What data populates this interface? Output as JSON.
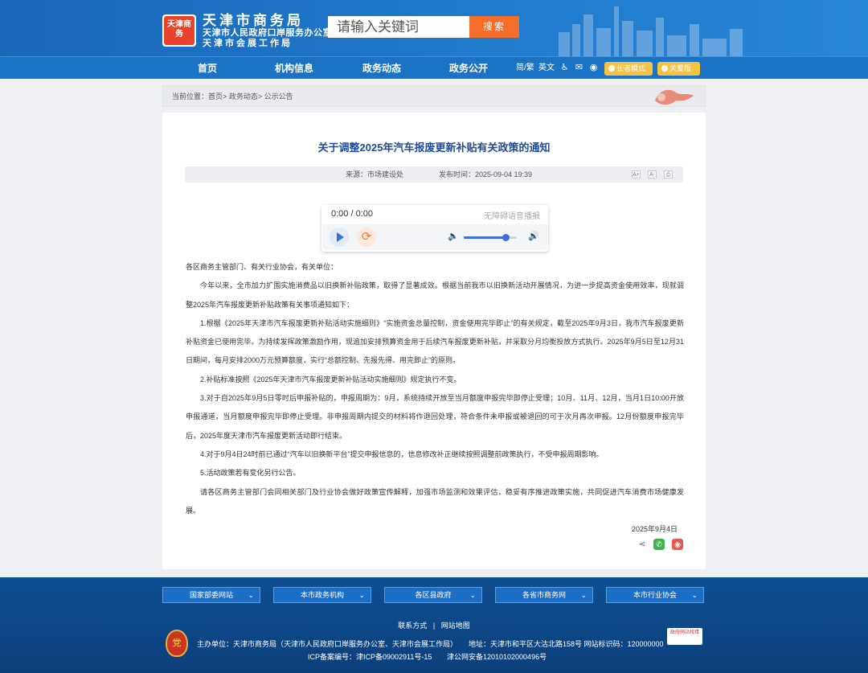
{
  "header": {
    "logo_text": "天津商务",
    "org_line1": "天津市商务局",
    "org_line2": "天津市人民政府口岸服务办公室",
    "org_line3": "天津市会展工作局",
    "search_placeholder": "请输入关键词",
    "search_button": "搜索"
  },
  "nav": {
    "items": [
      "首页",
      "机构信息",
      "政务动态",
      "政务公开"
    ],
    "lang_simple": "简/繁",
    "lang_english": "英文",
    "elder_mode": "长者模式",
    "care_version": "关爱版"
  },
  "breadcrumb": {
    "prefix": "当前位置：",
    "home": "首页",
    "level1": "政务动态",
    "level2": "公示公告",
    "sep": ">"
  },
  "article": {
    "title": "关于调整2025年汽车报废更新补贴有关政策的通知",
    "source": "来源：市场建设处",
    "publish_time": "发布时间：2025-09-04 19:39",
    "font_larger": "A+",
    "font_smaller": "A-",
    "paragraphs": [
      "各区商务主管部门、有关行业协会，有关单位：",
      "今年以来，全市加力扩围实施消费品以旧换新补贴政策，取得了显著成效。根据当前我市以旧换新活动开展情况，为进一步提高资金使用效率，现就调整2025年汽车报废更新补贴政策有关事项通知如下：",
      "1.根据《2025年天津市汽车报废更新补贴活动实施细则》“实施资金总量控制，资金使用完毕即止”的有关规定，截至2025年9月3日，我市汽车报废更新补贴资金已使用完毕。为持续发挥政策激励作用，现追加安排预算资金用于后续汽车报废更新补贴，并采取分月均衡投放方式执行。2025年9月5日至12月31日期间，每月安排2000万元预算额度，实行“总额控制、先报先得、用完即止”的原则。",
      "2.补贴标准按照《2025年天津市汽车报废更新补贴活动实施细则》规定执行不变。",
      "3.对于自2025年9月5日零时后申报补贴的，申报周期为：9月，系统持续开放至当月额度申报完毕即停止受理；10月、11月、12月，当月1日10:00开放申报通道，当月额度申报完毕即停止受理。非申报周期内提交的材料将作退回处理，符合条件未申报或被退回的可于次月再次申报。12月份额度申报完毕后，2025年度天津市汽车报废更新活动即行结束。",
      "4.对于9月4日24时前已通过“汽车以旧换新平台”提交申报信息的，信息修改补正继续按照调整前政策执行，不受申报周期影响。",
      "5.活动政策若有变化另行公告。",
      "请各区商务主管部门会同相关部门及行业协会做好政策宣传解释，加强市场监测和效果评估，稳妥有序推进政策实施，共同促进汽车消费市场健康发展。"
    ],
    "sign_date": "2025年9月4日"
  },
  "player": {
    "time": "0:00 / 0:00",
    "label": "无障碍语音播报",
    "volume": 0.8
  },
  "footer": {
    "dropdowns": [
      "国家部委网站",
      "本市政务机构",
      "各区县政府",
      "各省市商务网",
      "本市行业协会"
    ],
    "contact": "联系方式",
    "sitemap": "网站地图",
    "link_sep": "|",
    "emblem_text": "党",
    "host": "主办单位：天津市商务局（天津市人民政府口岸服务办公室、天津市会展工作局）",
    "address": "地址：天津市和平区大沽北路158号 网站标识码：120000000",
    "icp": "ICP备案编号：津ICP备09002911号-15",
    "police": "津公网安备12010102000496号",
    "badge": "政府网站找错"
  },
  "colors": {
    "header_blue": "#1b73c5",
    "search_orange": "#f36e2a",
    "title_blue": "#214c9a",
    "footer_navy": "#0b3f7a"
  }
}
